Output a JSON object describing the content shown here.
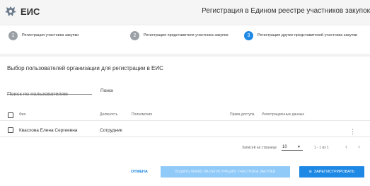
{
  "header": {
    "brand": "ЕИС",
    "title": "Регистрация в Едином реестре участников закупок"
  },
  "stepper": {
    "steps": [
      {
        "num": "1",
        "label": "Регистрация участника закупки"
      },
      {
        "num": "2",
        "label": "Регистрация представителя участника закупки"
      },
      {
        "num": "3",
        "label": "Регистрация других представителей участника закупки",
        "active": true
      }
    ]
  },
  "main": {
    "section_title": "Выбор пользователей организации для регистрации в ЕИС",
    "search": {
      "placeholder": "Поиск по пользователям",
      "button_label": "Поиск"
    },
    "table": {
      "columns": [
        "Фио",
        "Должность",
        "Полномочия",
        "Права доступа",
        "Регистрационные данные"
      ],
      "rows": [
        {
          "fio": "Квасхова Елена Сергеевна",
          "position": "Сотрудник",
          "powers": "",
          "access": "",
          "reg": ""
        }
      ]
    },
    "pager": {
      "rows_per_page_label": "Записей на странице",
      "rows_per_page_value": "10",
      "range": "1 - 1 из 1"
    }
  },
  "actions": {
    "cancel_label": "ОТМЕНА",
    "grant_label": "ВЫДАТЬ ПРАВО НА РЕГИСТРАЦИЮ УЧАСТНИКА ЗАКУПКИ",
    "register_label": "ЗАРЕГИСТРИРОВАТЬ"
  },
  "colors": {
    "accent": "#1e88e5",
    "disabled_button": "#90caf9"
  }
}
